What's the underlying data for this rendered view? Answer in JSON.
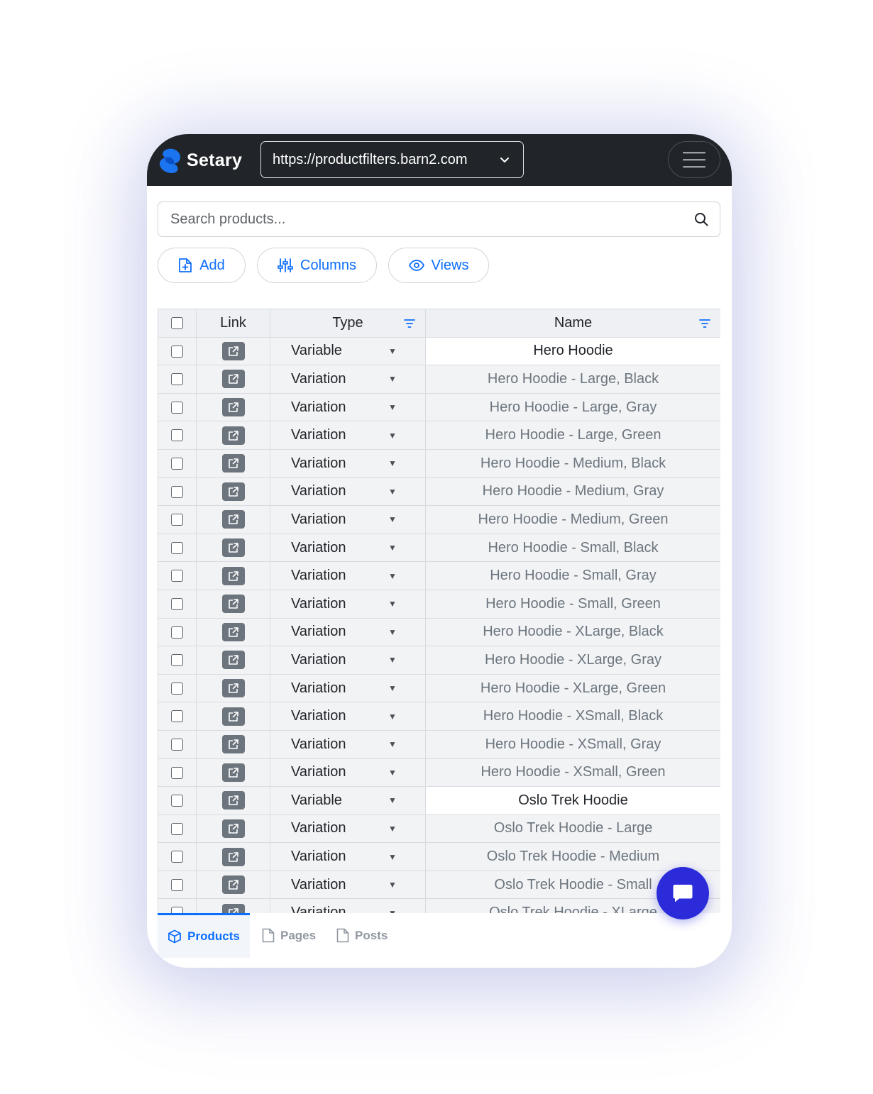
{
  "brand": {
    "name": "Setary",
    "accent": "#0d6efd"
  },
  "site_selector": {
    "value": "https://productfilters.barn2.com"
  },
  "search": {
    "placeholder": "Search products..."
  },
  "toolbar": {
    "add_label": "Add",
    "columns_label": "Columns",
    "views_label": "Views"
  },
  "table": {
    "headers": {
      "link": "Link",
      "type": "Type",
      "name": "Name"
    },
    "rows": [
      {
        "type": "Variable",
        "name": "Hero Hoodie",
        "parent": true
      },
      {
        "type": "Variation",
        "name": "Hero Hoodie - Large, Black",
        "parent": false
      },
      {
        "type": "Variation",
        "name": "Hero Hoodie - Large, Gray",
        "parent": false
      },
      {
        "type": "Variation",
        "name": "Hero Hoodie - Large, Green",
        "parent": false
      },
      {
        "type": "Variation",
        "name": "Hero Hoodie - Medium, Black",
        "parent": false
      },
      {
        "type": "Variation",
        "name": "Hero Hoodie - Medium, Gray",
        "parent": false
      },
      {
        "type": "Variation",
        "name": "Hero Hoodie - Medium, Green",
        "parent": false
      },
      {
        "type": "Variation",
        "name": "Hero Hoodie - Small, Black",
        "parent": false
      },
      {
        "type": "Variation",
        "name": "Hero Hoodie - Small, Gray",
        "parent": false
      },
      {
        "type": "Variation",
        "name": "Hero Hoodie - Small, Green",
        "parent": false
      },
      {
        "type": "Variation",
        "name": "Hero Hoodie - XLarge, Black",
        "parent": false
      },
      {
        "type": "Variation",
        "name": "Hero Hoodie - XLarge, Gray",
        "parent": false
      },
      {
        "type": "Variation",
        "name": "Hero Hoodie - XLarge, Green",
        "parent": false
      },
      {
        "type": "Variation",
        "name": "Hero Hoodie - XSmall, Black",
        "parent": false
      },
      {
        "type": "Variation",
        "name": "Hero Hoodie - XSmall, Gray",
        "parent": false
      },
      {
        "type": "Variation",
        "name": "Hero Hoodie - XSmall, Green",
        "parent": false
      },
      {
        "type": "Variable",
        "name": "Oslo Trek Hoodie",
        "parent": true
      },
      {
        "type": "Variation",
        "name": "Oslo Trek Hoodie - Large",
        "parent": false
      },
      {
        "type": "Variation",
        "name": "Oslo Trek Hoodie - Medium",
        "parent": false
      },
      {
        "type": "Variation",
        "name": "Oslo Trek Hoodie - Small",
        "parent": false
      },
      {
        "type": "Variation",
        "name": "Oslo Trek Hoodie - XLarge",
        "parent": false
      }
    ]
  },
  "tabs": [
    {
      "label": "Products",
      "active": true
    },
    {
      "label": "Pages",
      "active": false
    },
    {
      "label": "Posts",
      "active": false
    }
  ],
  "icons": {
    "logo": "setary-logo-icon",
    "chevron": "chevron-down-icon",
    "menu": "hamburger-menu-icon",
    "search": "search-icon",
    "add": "file-plus-icon",
    "columns": "sliders-icon",
    "views": "eye-icon",
    "link": "external-link-icon",
    "filter": "filter-icon",
    "chat": "chat-icon"
  },
  "colors": {
    "topbar": "#212529",
    "chat_button": "#2b2bd9",
    "link_button": "#6c757d"
  }
}
